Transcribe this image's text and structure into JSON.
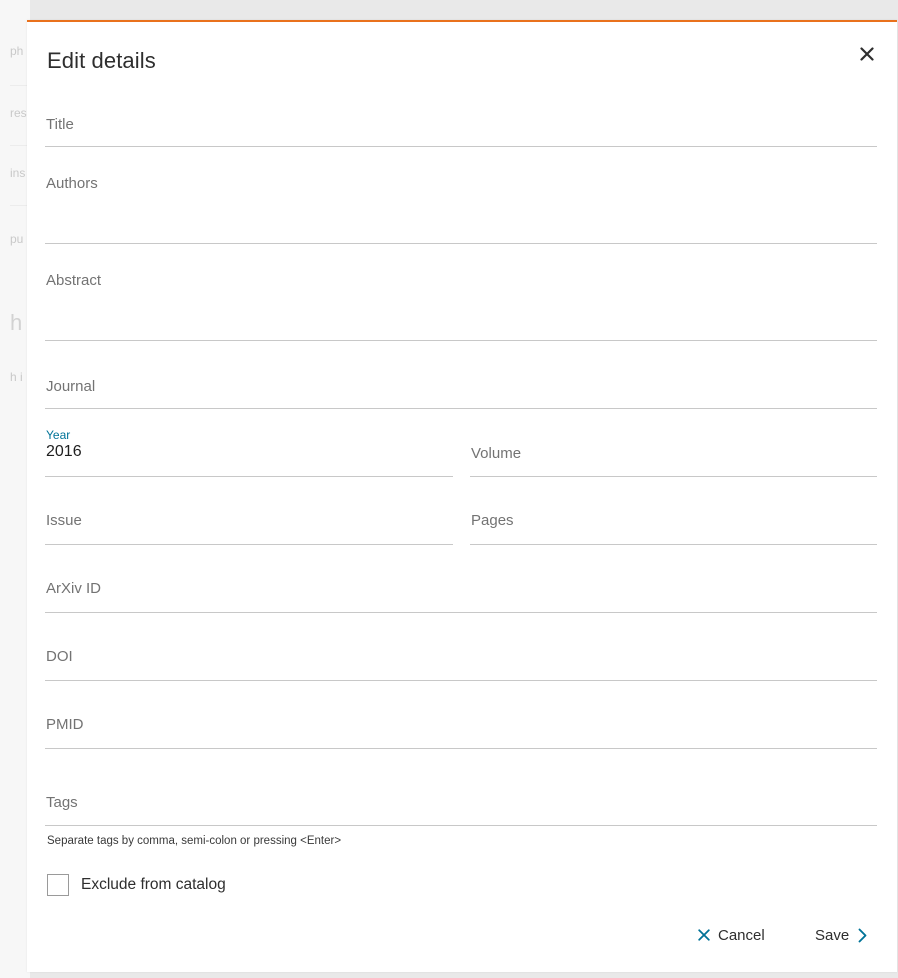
{
  "background": {
    "ghost_fragments": [
      "ph",
      "res",
      "ins",
      "pu",
      "h",
      "h i"
    ]
  },
  "modal": {
    "title": "Edit details",
    "accent_color": "#e9711c",
    "link_color": "#007398",
    "close_icon": "close-icon"
  },
  "fields": {
    "title": {
      "placeholder": "Title"
    },
    "authors": {
      "placeholder": "Authors"
    },
    "abstract": {
      "placeholder": "Abstract"
    },
    "journal": {
      "placeholder": "Journal"
    },
    "year": {
      "label": "Year",
      "value": "2016"
    },
    "volume": {
      "placeholder": "Volume"
    },
    "issue": {
      "placeholder": "Issue"
    },
    "pages": {
      "placeholder": "Pages"
    },
    "arxiv": {
      "placeholder": "ArXiv ID"
    },
    "doi": {
      "placeholder": "DOI"
    },
    "pmid": {
      "placeholder": "PMID"
    },
    "tags": {
      "placeholder": "Tags",
      "hint": "Separate tags by comma, semi-colon or pressing <Enter>"
    }
  },
  "exclude": {
    "label": "Exclude from catalog",
    "checked": false
  },
  "actions": {
    "cancel_label": "Cancel",
    "cancel_icon": "close-icon",
    "save_label": "Save",
    "save_icon": "chevron-right-icon"
  }
}
